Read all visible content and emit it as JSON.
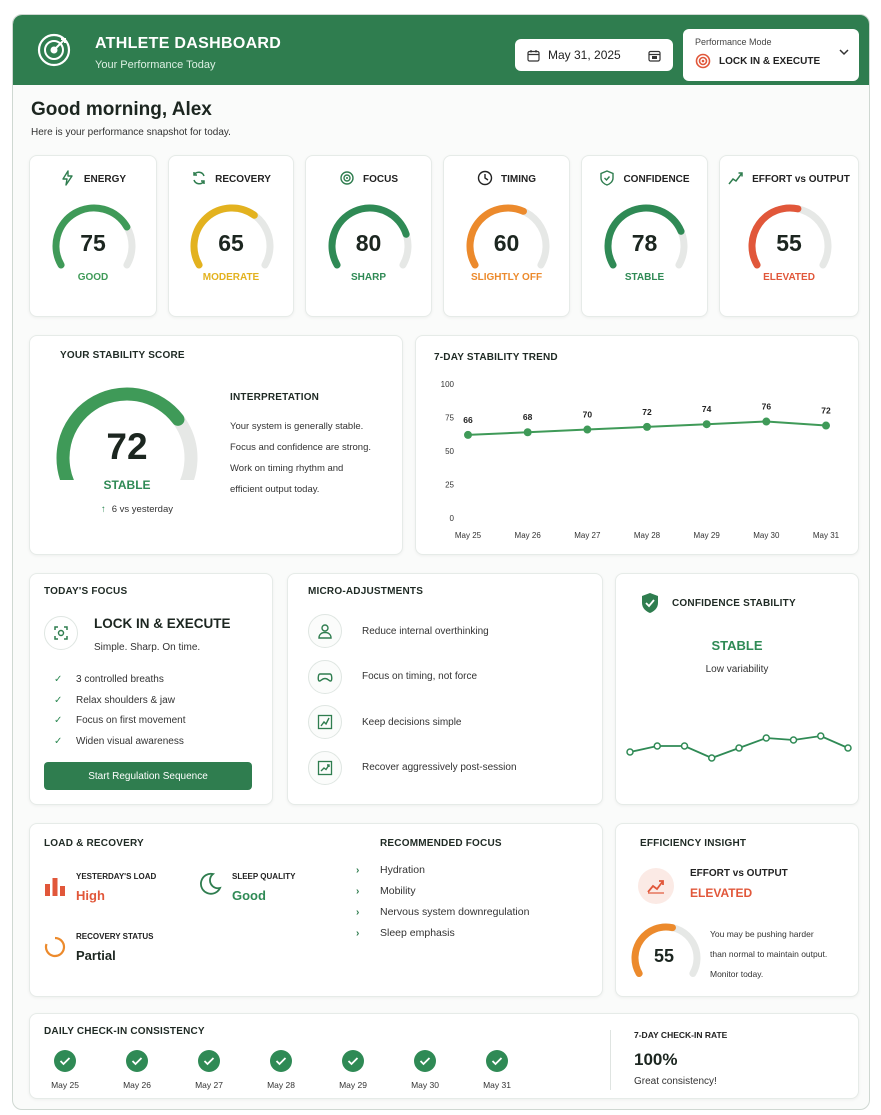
{
  "header": {
    "title": "ATHLETE DASHBOARD",
    "subtitle": "Your Performance Today",
    "date": "May 31, 2025",
    "mode_label": "Performance Mode",
    "mode_value": "LOCK IN & EXECUTE"
  },
  "greeting": {
    "title": "Good morning, Alex",
    "subtitle": "Here is your performance snapshot for today."
  },
  "metrics": [
    {
      "label": "ENERGY",
      "value": "75",
      "fraction": 0.75,
      "status": "GOOD",
      "color": "#3f9a58",
      "icon": "lightning-icon"
    },
    {
      "label": "RECOVERY",
      "value": "65",
      "fraction": 0.65,
      "status": "MODERATE",
      "color": "#e3b21f",
      "icon": "refresh-icon"
    },
    {
      "label": "FOCUS",
      "value": "80",
      "fraction": 0.8,
      "status": "SHARP",
      "color": "#2f8a55",
      "icon": "target-icon"
    },
    {
      "label": "TIMING",
      "value": "60",
      "fraction": 0.6,
      "status": "SLIGHTLY OFF",
      "color": "#ec8a2c",
      "icon": "clock-icon"
    },
    {
      "label": "CONFIDENCE",
      "value": "78",
      "fraction": 0.78,
      "status": "STABLE",
      "color": "#2f8a55",
      "icon": "shield-icon"
    },
    {
      "label": "EFFORT vs OUTPUT",
      "value": "55",
      "fraction": 0.55,
      "status": "ELEVATED",
      "color": "#e1573a",
      "icon": "trend-chart-icon"
    }
  ],
  "stability": {
    "title": "YOUR STABILITY SCORE",
    "score": "72",
    "fraction": 0.72,
    "status": "STABLE",
    "delta": "6 vs yesterday",
    "interp_title": "INTERPRETATION",
    "interp_lines": [
      "Your system is generally stable.",
      "Focus and confidence are strong.",
      "Work on timing rhythm and",
      "efficient output today."
    ]
  },
  "chart_data": {
    "type": "line",
    "title": "7-DAY STABILITY TREND",
    "categories": [
      "May 25",
      "May 26",
      "May 27",
      "May 28",
      "May 29",
      "May 30",
      "May 31"
    ],
    "values": [
      66,
      68,
      70,
      72,
      74,
      76,
      72
    ],
    "series_plotted": [
      62,
      64,
      66,
      68,
      70,
      72,
      69
    ],
    "ylim": [
      0,
      100
    ],
    "yticks": [
      0,
      25,
      50,
      75,
      100
    ],
    "grid": false,
    "color": "#3f9a58"
  },
  "today_focus": {
    "title": "TODAY'S FOCUS",
    "mode": "LOCK IN & EXECUTE",
    "tagline": "Simple. Sharp. On time.",
    "items": [
      "3 controlled breaths",
      "Relax shoulders & jaw",
      "Focus on first movement",
      "Widen visual awareness"
    ],
    "button": "Start Regulation Sequence"
  },
  "micro": {
    "title": "MICRO-ADJUSTMENTS",
    "items": [
      {
        "label": "Reduce internal overthinking",
        "icon": "person-icon"
      },
      {
        "label": "Focus on timing, not force",
        "icon": "gamepad-icon"
      },
      {
        "label": "Keep decisions simple",
        "icon": "chart-icon"
      },
      {
        "label": "Recover aggressively post-session",
        "icon": "growth-icon"
      }
    ]
  },
  "confidence": {
    "title": "CONFIDENCE STABILITY",
    "status": "STABLE",
    "sub": "Low variability",
    "spark": [
      38,
      32,
      32,
      44,
      34,
      24,
      26,
      22,
      34
    ]
  },
  "load": {
    "title": "LOAD & RECOVERY",
    "yload_label": "YESTERDAY'S LOAD",
    "yload_value": "High",
    "sleep_label": "SLEEP QUALITY",
    "sleep_value": "Good",
    "recovery_label": "RECOVERY STATUS",
    "recovery_value": "Partial",
    "rec_title": "RECOMMENDED FOCUS",
    "rec_items": [
      "Hydration",
      "Mobility",
      "Nervous system downregulation",
      "Sleep emphasis"
    ]
  },
  "efficiency": {
    "title": "EFFICIENCY INSIGHT",
    "metric": "EFFORT vs OUTPUT",
    "status": "ELEVATED",
    "value": "55",
    "fraction": 0.55,
    "note_lines": [
      "You may be pushing harder",
      "than normal to maintain output.",
      "Monitor today."
    ]
  },
  "checkin": {
    "title": "DAILY CHECK-IN CONSISTENCY",
    "days": [
      "May 25",
      "May 26",
      "May 27",
      "May 28",
      "May 29",
      "May 30",
      "May 31"
    ],
    "rate_label": "7-DAY CHECK-IN RATE",
    "rate_value": "100%",
    "rate_note": "Great consistency!"
  },
  "colors": {
    "brand": "#2f7d4f",
    "green": "#3f9a58",
    "yellow": "#e3b21f",
    "orange": "#ec8a2c",
    "red": "#e1573a",
    "track": "#e6e8e6"
  }
}
